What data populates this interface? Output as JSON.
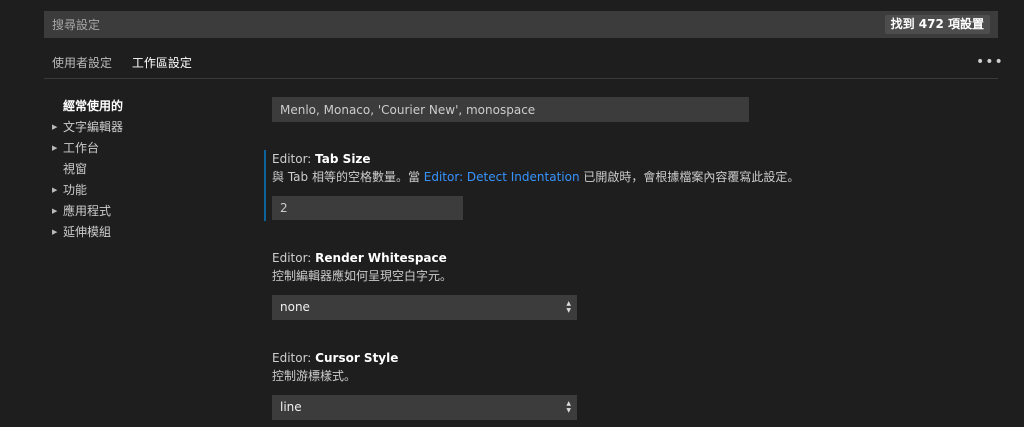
{
  "search": {
    "placeholder": "搜尋設定",
    "value": "",
    "result_count": "找到 472 項設置"
  },
  "tabs": [
    {
      "label": "使用者設定",
      "active": false
    },
    {
      "label": "工作區設定",
      "active": true
    }
  ],
  "more_label": "•••",
  "toc": [
    {
      "label": "經常使用的",
      "expandable": false,
      "active": true
    },
    {
      "label": "文字編輯器",
      "expandable": true,
      "active": false
    },
    {
      "label": "工作台",
      "expandable": true,
      "active": false
    },
    {
      "label": "視窗",
      "expandable": false,
      "active": false
    },
    {
      "label": "功能",
      "expandable": true,
      "active": false
    },
    {
      "label": "應用程式",
      "expandable": true,
      "active": false
    },
    {
      "label": "延伸模組",
      "expandable": true,
      "active": false
    }
  ],
  "settings": {
    "font_family": {
      "value": "Menlo, Monaco, 'Courier New', monospace"
    },
    "tab_size": {
      "category": "Editor: ",
      "name": "Tab Size",
      "desc_before": "與 Tab 相等的空格數量。當 ",
      "desc_link": "Editor: Detect Indentation",
      "desc_after": " 已開啟時，會根據檔案內容覆寫此設定。",
      "value": "2"
    },
    "render_whitespace": {
      "category": "Editor: ",
      "name": "Render Whitespace",
      "desc": "控制編輯器應如何呈現空白字元。",
      "value": "none"
    },
    "cursor_style": {
      "category": "Editor: ",
      "name": "Cursor Style",
      "desc": "控制游標樣式。",
      "value": "line"
    }
  },
  "colors": {
    "accent": "#0e639c",
    "link": "#3794ff",
    "background": "#1e1e1e"
  },
  "icons": {
    "chevron": "chevron-right-icon",
    "select": "select-arrows-icon",
    "more": "more-icon"
  }
}
